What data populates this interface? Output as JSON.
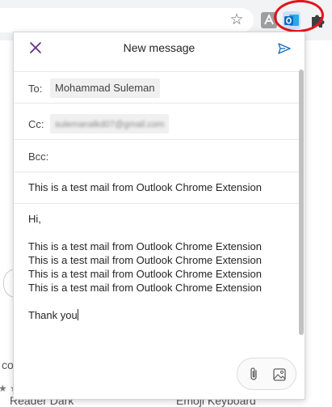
{
  "compose": {
    "title": "New message",
    "to_label": "To:",
    "to_value": "Mohammad Suleman",
    "cc_label": "Cc:",
    "cc_value": "sulemanalkd07@gmail.com",
    "bcc_label": "Bcc:",
    "subject": "This is a test mail from Outlook Chrome Extension",
    "body_lines": [
      "Hi,",
      "",
      "This is a test mail from Outlook Chrome Extension",
      "This is a test mail from Outlook Chrome Extension",
      "This is a test mail from Outlook Chrome Extension",
      "This is a test mail from Outlook Chrome Extension",
      "",
      "Thank you"
    ]
  },
  "background_page": {
    "bottom_left_text": "Reader Dark",
    "bottom_right_text": "Emoji Keyboard",
    "left_fragment": "co"
  },
  "icons": {
    "close": "close-icon",
    "send": "send-icon",
    "attach": "paperclip-icon",
    "image": "image-icon",
    "star": "star-icon",
    "outlook": "outlook-icon",
    "puzzle": "puzzle-icon"
  },
  "colors": {
    "accent": "#0f6cbd",
    "highlight_ring": "#e3141d",
    "toolbar": "#f1f3f4"
  }
}
